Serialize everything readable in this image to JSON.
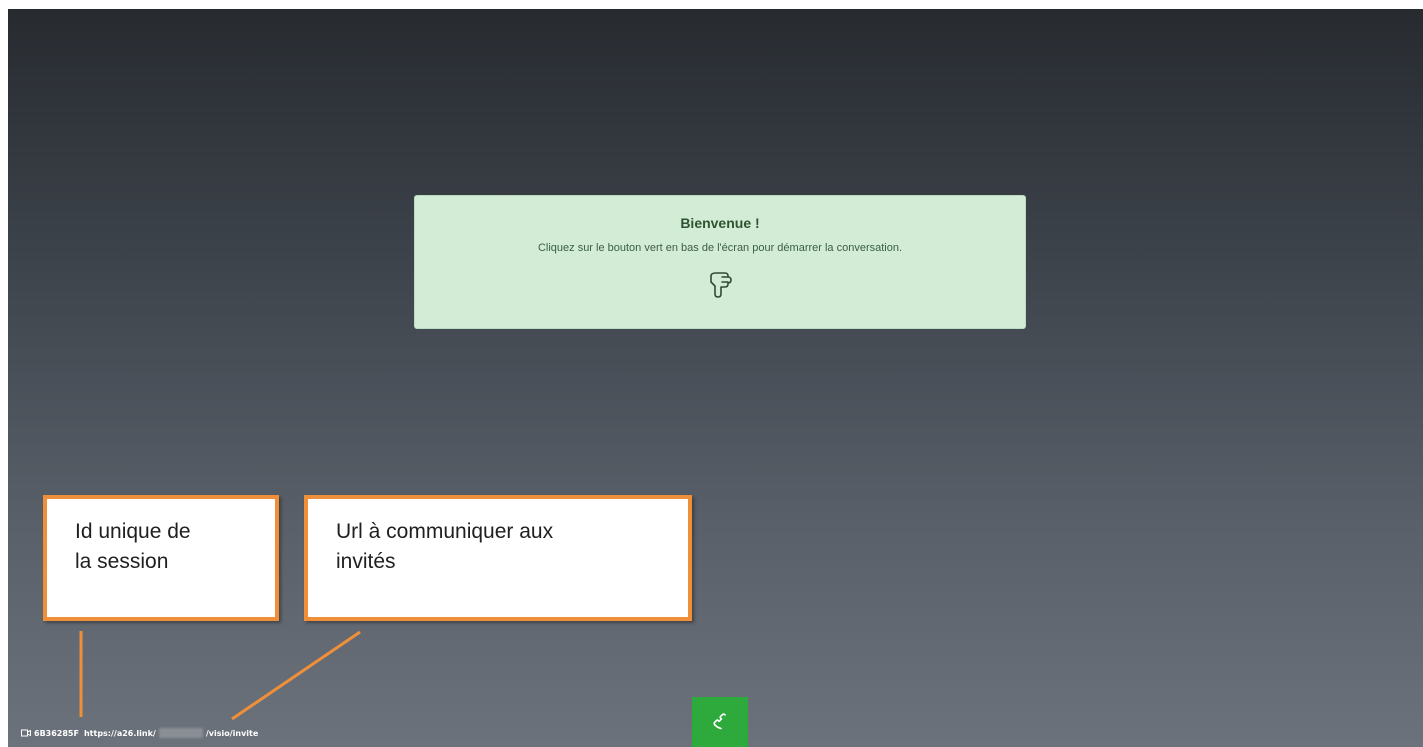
{
  "welcome": {
    "title": "Bienvenue !",
    "message": "Cliquez sur le bouton vert en bas de l'écran pour démarrer la conversation.",
    "icon": "hand-pointing-down-icon"
  },
  "annotations": {
    "session_id_label": [
      "Id unique de",
      "la session"
    ],
    "url_label": [
      "Url à communiquer aux",
      "invités"
    ]
  },
  "session_bar": {
    "camera_icon": "camera-icon",
    "session_id": "6B36285F",
    "url_prefix": "https://a26.link/",
    "url_suffix": "/visio/invite"
  },
  "call_button": {
    "icon": "phone-icon",
    "color": "#2eaa3c"
  },
  "colors": {
    "card_background": "#d3ecd6",
    "callout_border": "#ef8f3a",
    "call_button": "#2eaa3c"
  }
}
